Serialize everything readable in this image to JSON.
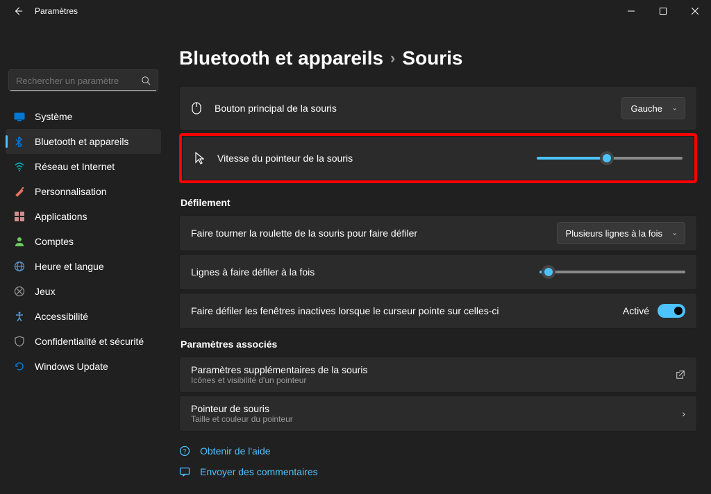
{
  "window": {
    "title": "Paramètres"
  },
  "search": {
    "placeholder": "Rechercher un paramètre"
  },
  "nav": [
    {
      "label": "Système",
      "icon": "system-icon",
      "color": "#0078d4"
    },
    {
      "label": "Bluetooth et appareils",
      "icon": "bluetooth-icon",
      "color": "#0078d4",
      "active": true
    },
    {
      "label": "Réseau et Internet",
      "icon": "wifi-icon",
      "color": "#00b7c3"
    },
    {
      "label": "Personnalisation",
      "icon": "brush-icon",
      "color": "#e3735e"
    },
    {
      "label": "Applications",
      "icon": "apps-icon",
      "color": "#d08f8f"
    },
    {
      "label": "Comptes",
      "icon": "person-icon",
      "color": "#6ccb5f"
    },
    {
      "label": "Heure et langue",
      "icon": "globe-icon",
      "color": "#5b9bd5"
    },
    {
      "label": "Jeux",
      "icon": "xbox-icon",
      "color": "#9a9a9a"
    },
    {
      "label": "Accessibilité",
      "icon": "accessibility-icon",
      "color": "#5b9bd5"
    },
    {
      "label": "Confidentialité et sécurité",
      "icon": "shield-icon",
      "color": "#9a9a9a"
    },
    {
      "label": "Windows Update",
      "icon": "update-icon",
      "color": "#0078d4"
    }
  ],
  "breadcrumb": {
    "parent": "Bluetooth et appareils",
    "current": "Souris"
  },
  "rows": {
    "primary_button": {
      "label": "Bouton principal de la souris",
      "value": "Gauche"
    },
    "pointer_speed": {
      "label": "Vitesse du pointeur de la souris",
      "percent": 48
    },
    "scroll_roulette": {
      "label": "Faire tourner la roulette de la souris pour faire défiler",
      "value": "Plusieurs lignes à la fois"
    },
    "lines_scroll": {
      "label": "Lignes à faire défiler à la fois",
      "percent": 6
    },
    "inactive_scroll": {
      "label": "Faire défiler les fenêtres inactives lorsque le curseur pointe sur celles-ci",
      "state": "Activé"
    }
  },
  "sections": {
    "defilement": "Défilement",
    "associes": "Paramètres associés"
  },
  "related": [
    {
      "title": "Paramètres supplémentaires de la souris",
      "subtitle": "Icônes et visibilité d'un pointeur",
      "action": "open-external"
    },
    {
      "title": "Pointeur de souris",
      "subtitle": "Taille et couleur du pointeur",
      "action": "navigate"
    }
  ],
  "help": [
    {
      "label": "Obtenir de l'aide",
      "icon": "help-icon"
    },
    {
      "label": "Envoyer des commentaires",
      "icon": "feedback-icon"
    }
  ]
}
